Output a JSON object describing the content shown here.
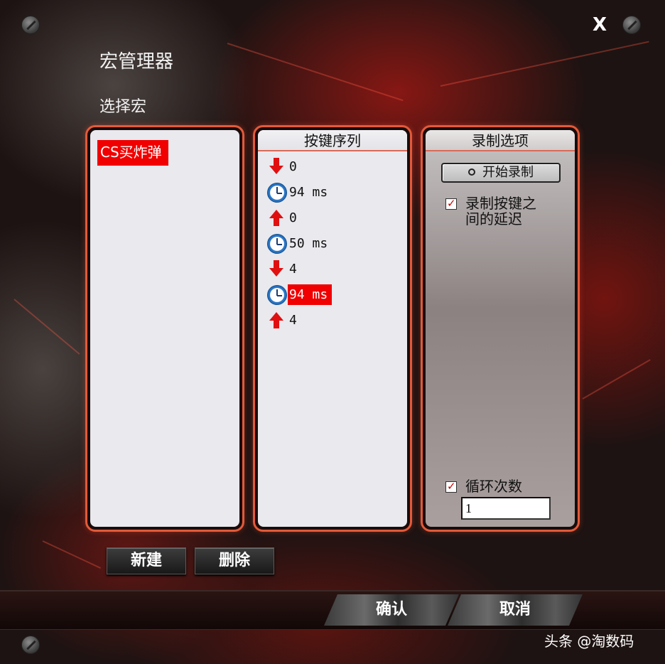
{
  "window": {
    "title": "宏管理器",
    "close_label": "X"
  },
  "macro_section": {
    "label": "选择宏",
    "items": [
      {
        "label": "CS买炸弹",
        "selected": true
      }
    ],
    "new_label": "新建",
    "delete_label": "删除"
  },
  "sequence": {
    "header": "按键序列",
    "rows": [
      {
        "type": "key-down",
        "icon": "arrow-down-icon",
        "text": "0"
      },
      {
        "type": "delay",
        "icon": "clock-icon",
        "text": "94 ms"
      },
      {
        "type": "key-up",
        "icon": "arrow-up-icon",
        "text": "0"
      },
      {
        "type": "delay",
        "icon": "clock-icon",
        "text": "50 ms"
      },
      {
        "type": "key-down",
        "icon": "arrow-down-icon",
        "text": "4"
      },
      {
        "type": "delay",
        "icon": "clock-icon",
        "text": "94 ms",
        "selected": true
      },
      {
        "type": "key-up",
        "icon": "arrow-up-icon",
        "text": "4"
      }
    ]
  },
  "options": {
    "header": "录制选项",
    "start_record_label": "开始录制",
    "record_delay_label_line1": "录制按键之",
    "record_delay_label_line2": "间的延迟",
    "record_delay_checked": true,
    "loop_label": "循环次数",
    "loop_checked": true,
    "loop_count": "1"
  },
  "footer": {
    "confirm_label": "确认",
    "cancel_label": "取消"
  },
  "watermark": "头条 @淘数码",
  "colors": {
    "accent_red": "#f00000",
    "panel_border": "#e25a3a",
    "clock_blue": "#2a78c8"
  }
}
